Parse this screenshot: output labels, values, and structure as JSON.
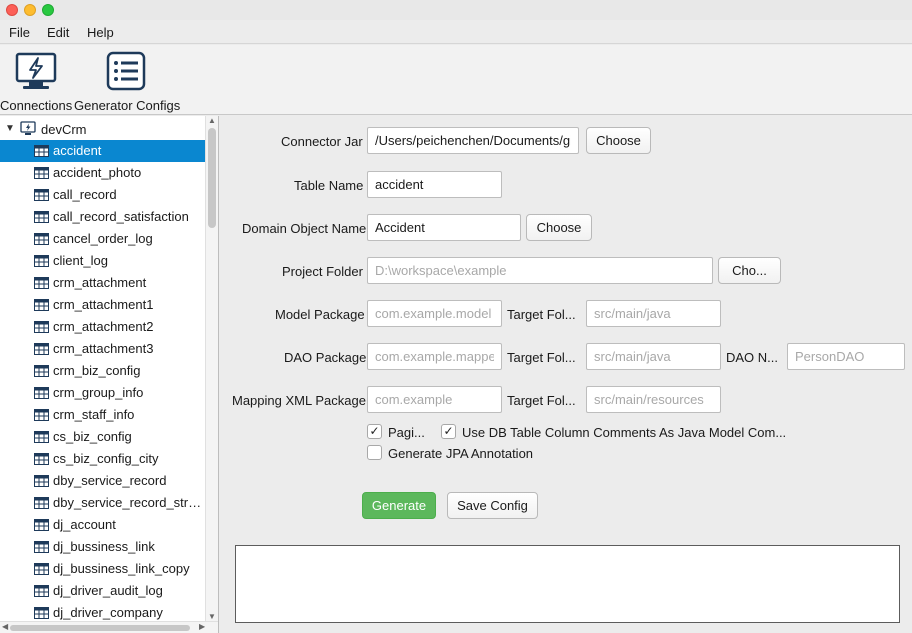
{
  "menu": [
    "File",
    "Edit",
    "Help"
  ],
  "toolbar": {
    "connections_label": "Connections",
    "configs_label": "Generator Configs",
    "connections_icon": "monitor-bolt-icon",
    "configs_icon": "list-icon"
  },
  "tree": {
    "root": "devCrm",
    "items": [
      "accident",
      "accident_photo",
      "call_record",
      "call_record_satisfaction",
      "cancel_order_log",
      "client_log",
      "crm_attachment",
      "crm_attachment1",
      "crm_attachment2",
      "crm_attachment3",
      "crm_biz_config",
      "crm_group_info",
      "crm_staff_info",
      "cs_biz_config",
      "cs_biz_config_city",
      "dby_service_record",
      "dby_service_record_stre...",
      "dj_account",
      "dj_bussiness_link",
      "dj_bussiness_link_copy",
      "dj_driver_audit_log",
      "dj_driver_company"
    ],
    "selected": "accident"
  },
  "form": {
    "connector_jar_label": "Connector Jar",
    "connector_jar_value": "/Users/peichenchen/Documents/git",
    "choose_label": "Choose",
    "table_name_label": "Table Name",
    "table_name_value": "accident",
    "domain_object_label": "Domain Object Name",
    "domain_object_value": "Accident",
    "project_folder_label": "Project Folder",
    "project_folder_placeholder": "D:\\workspace\\example",
    "project_folder_button": "Cho...",
    "model_package_label": "Model Package",
    "model_package_placeholder": "com.example.model",
    "target_folder_label": "Target Fol...",
    "model_target_placeholder": "src/main/java",
    "dao_package_label": "DAO Package",
    "dao_package_placeholder": "com.example.mapper",
    "dao_target_placeholder": "src/main/java",
    "dao_name_label": "DAO N...",
    "dao_name_placeholder": "PersonDAO",
    "mapping_xml_label": "Mapping XML Package",
    "mapping_xml_placeholder": "com.example",
    "mapping_target_placeholder": "src/main/resources",
    "pagination_label": "Pagi...",
    "pagination_checked": true,
    "use_comments_label": "Use DB Table Column Comments As Java Model Com...",
    "use_comments_checked": true,
    "jpa_label": "Generate JPA Annotation",
    "jpa_checked": false,
    "generate_button": "Generate",
    "save_config_button": "Save Config",
    "generate_color": "#5cb85c"
  },
  "colors": {
    "selection": "#0a87d0"
  }
}
